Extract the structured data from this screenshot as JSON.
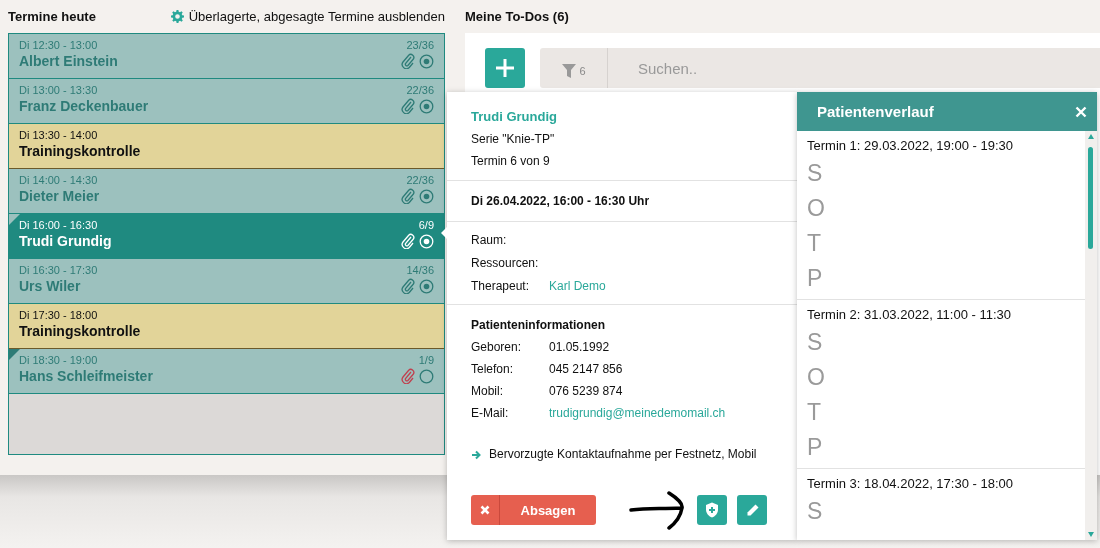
{
  "appointments_panel": {
    "title": "Termine heute",
    "toggle_label": "Überlagerte, abgesagte Termine ausblenden"
  },
  "appointments": [
    {
      "kind": "patient",
      "time": "Di 12:30 - 13:00",
      "name": "Albert Einstein",
      "count": "23/36",
      "selected": false,
      "corner_marker": false,
      "attachment_flagged": false,
      "status_done": true
    },
    {
      "kind": "patient",
      "time": "Di 13:00 - 13:30",
      "name": "Franz Deckenbauer",
      "count": "22/36",
      "selected": false,
      "corner_marker": false,
      "attachment_flagged": false,
      "status_done": true
    },
    {
      "kind": "block",
      "time": "Di 13:30 - 14:00",
      "name": "Trainingskontrolle",
      "selected": false
    },
    {
      "kind": "patient",
      "time": "Di 14:00 - 14:30",
      "name": "Dieter Meier",
      "count": "22/36",
      "selected": false,
      "corner_marker": false,
      "attachment_flagged": false,
      "status_done": true
    },
    {
      "kind": "patient",
      "time": "Di 16:00 - 16:30",
      "name": "Trudi Grundig",
      "count": "6/9",
      "selected": true,
      "corner_marker": true,
      "attachment_flagged": false,
      "status_done": true
    },
    {
      "kind": "patient",
      "time": "Di 16:30 - 17:30",
      "name": "Urs Wiler",
      "count": "14/36",
      "selected": false,
      "corner_marker": false,
      "attachment_flagged": false,
      "status_done": true
    },
    {
      "kind": "block",
      "time": "Di 17:30 - 18:00",
      "name": "Trainingskontrolle",
      "selected": false
    },
    {
      "kind": "patient",
      "time": "Di 18:30 - 19:00",
      "name": "Hans Schleifmeister",
      "count": "1/9",
      "selected": false,
      "corner_marker": true,
      "attachment_flagged": true,
      "status_done": false
    }
  ],
  "todos": {
    "title": "Meine To-Dos (6)",
    "filter_count": "6",
    "search": {
      "placeholder": "Suchen.."
    }
  },
  "popup": {
    "patient_name": "Trudi Grundig",
    "series": "Serie \"Knie-TP\"",
    "session": "Termin 6 von 9",
    "datetime": "Di 26.04.2022, 16:00 - 16:30 Uhr",
    "details": [
      {
        "label": "Raum:"
      },
      {
        "label": "Ressourcen:"
      },
      {
        "label": "Therapeut:",
        "value": "Karl Demo",
        "kind": "link"
      }
    ],
    "patient_info_title": "Patienteninformationen",
    "patient_info": [
      {
        "label": "Geboren:",
        "value": "01.05.1992",
        "kind": "text"
      },
      {
        "label": "Telefon:",
        "value": "045 2147 856",
        "kind": "text"
      },
      {
        "label": "Mobil:",
        "value": "076 5239 874",
        "kind": "text"
      },
      {
        "label": "E-Mail:",
        "value": "trudigrundig@meinedemomail.ch",
        "kind": "link"
      }
    ],
    "contact_note": "Bervorzugte Kontaktaufnahme per Festnetz, Mobil",
    "cancel_button": "Absagen"
  },
  "history": {
    "title": "Patientenverlauf",
    "entries": [
      {
        "title": "Termin 1: 29.03.2022, 19:00 - 19:30",
        "letters": [
          "S",
          "O",
          "T",
          "P"
        ]
      },
      {
        "title": "Termin 2: 31.03.2022, 11:00 - 11:30",
        "letters": [
          "S",
          "O",
          "T",
          "P"
        ]
      },
      {
        "title": "Termin 3: 18.04.2022, 17:30 - 18:00",
        "letters": [
          "S"
        ]
      }
    ]
  }
}
